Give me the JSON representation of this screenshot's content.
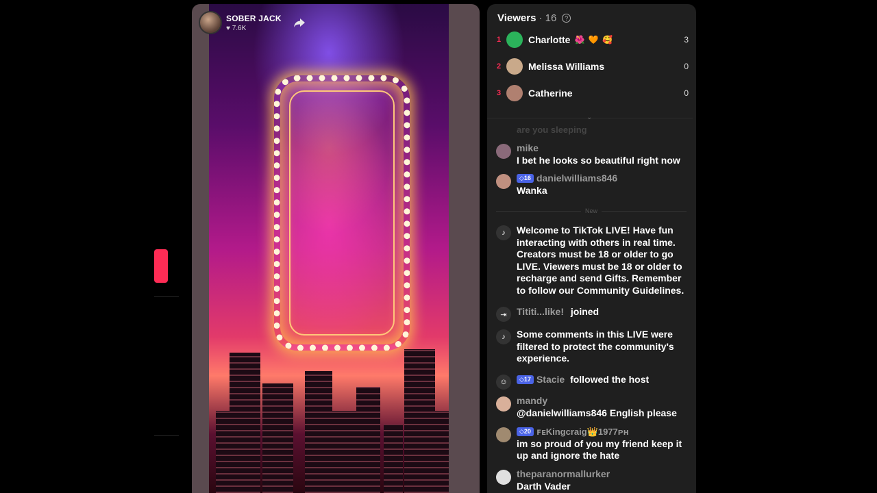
{
  "host": {
    "name": "SOBER JACK",
    "likes": "7.6K"
  },
  "viewers": {
    "title": "Viewers",
    "count": "· 16",
    "list": [
      {
        "rank": "1",
        "name": "Charlotte",
        "badges": "🌺 🧡 🥰",
        "score": "3",
        "color": "#34c76a"
      },
      {
        "rank": "2",
        "name": "Melissa Williams",
        "badges": "",
        "score": "0",
        "color": "#c9a98a"
      },
      {
        "rank": "3",
        "name": "Catherine",
        "badges": "",
        "score": "0",
        "color": "#b08070"
      }
    ]
  },
  "chat": {
    "faded": "are you sleeping",
    "new_label": "New",
    "messages": [
      {
        "user": "mike",
        "text": "I bet he looks so beautiful right now"
      },
      {
        "user": "danielwilliams846",
        "level": "16",
        "text": "Wanka"
      },
      {
        "system": "Welcome to TikTok LIVE! Have fun interacting with others in real time. Creators must be 18 or older to go LIVE. Viewers must be 18 or older to recharge and send Gifts. Remember to follow our Community Guidelines."
      },
      {
        "user": "Tititi...like!",
        "text": "joined"
      },
      {
        "system": "Some comments in this LIVE were filtered to protect the community's experience."
      },
      {
        "user": "Stacie",
        "level": "17",
        "text": "followed the host"
      },
      {
        "user": "mandy",
        "text": "@danielwilliams846 English please"
      },
      {
        "user": "ꜰᴇKingcraig👑1977ᴘʜ",
        "level": "20",
        "text": "im so proud of you my friend keep it up and ignore the hate"
      },
      {
        "user": "theparanormallurker",
        "text": "Darth Vader"
      }
    ]
  }
}
